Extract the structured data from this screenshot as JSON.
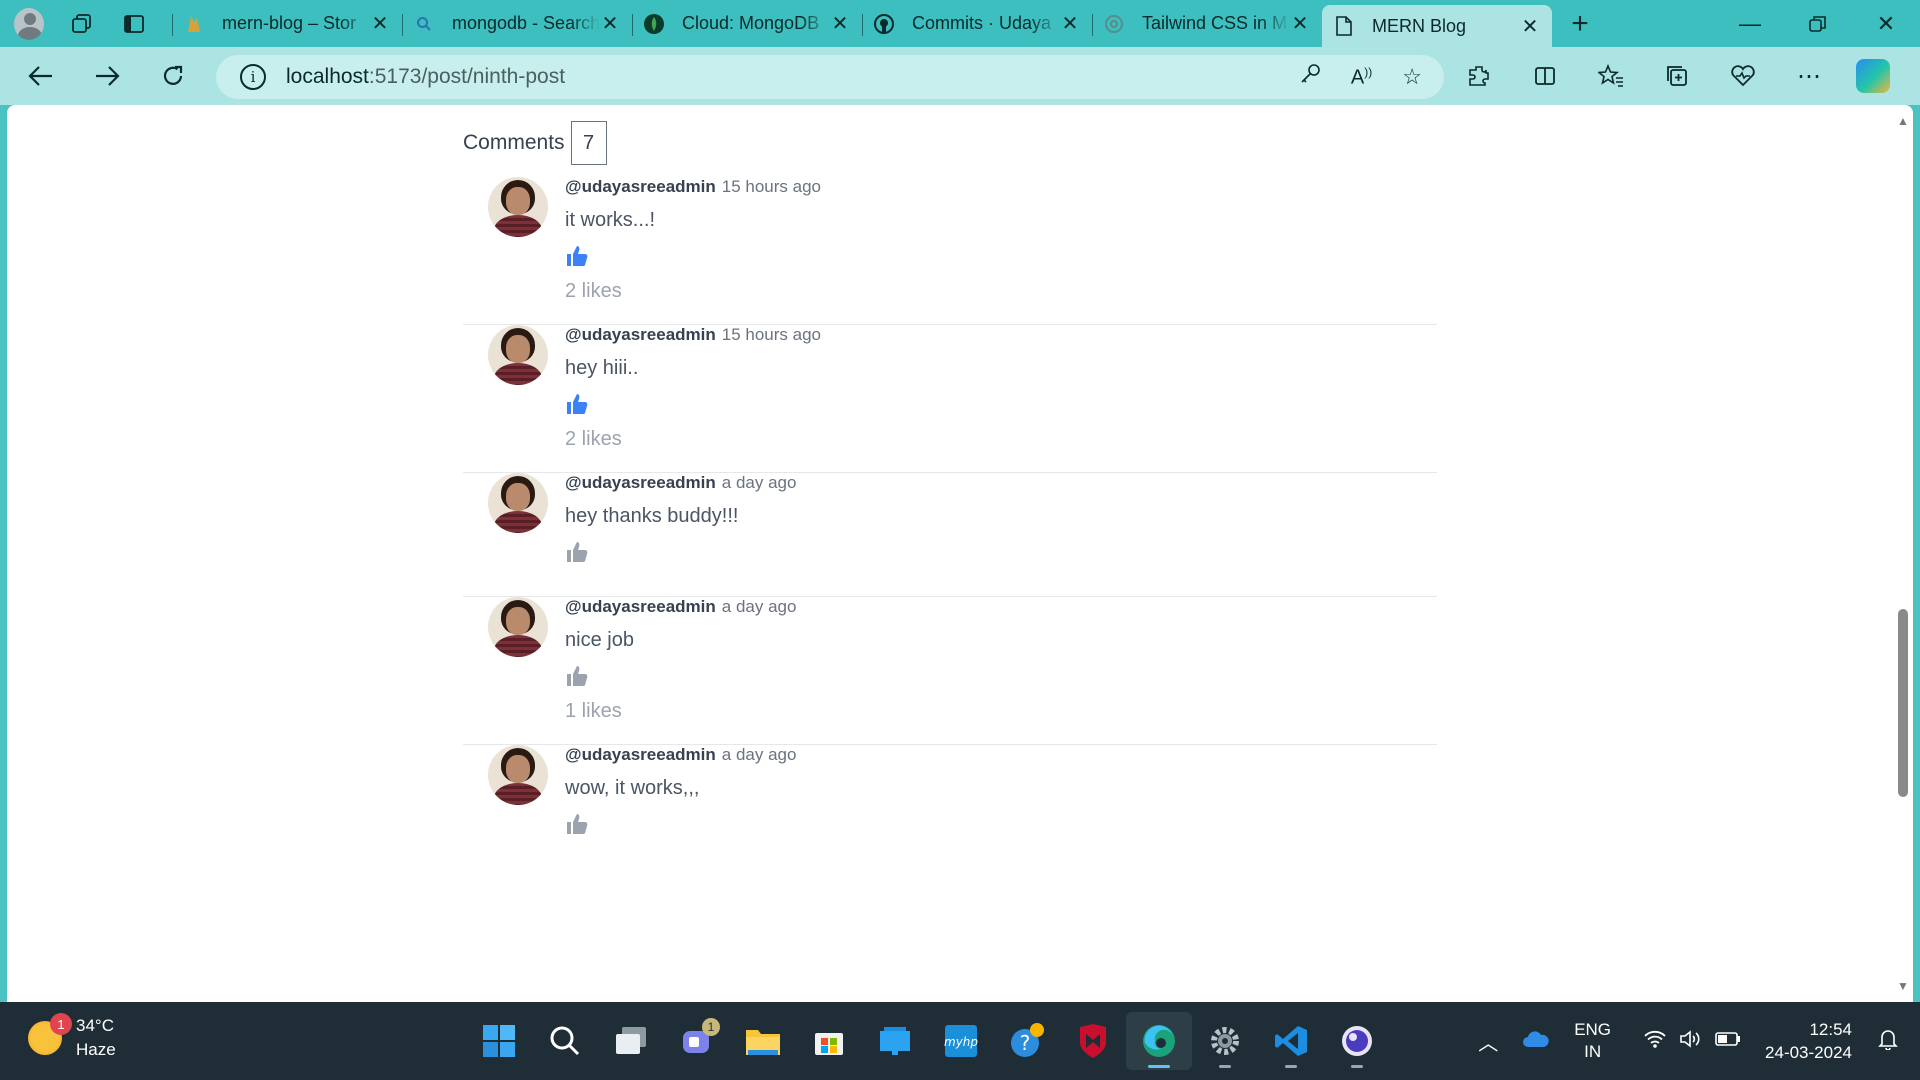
{
  "browser": {
    "tabs": [
      {
        "title": "mern-blog – Stor",
        "favicon": "firebase"
      },
      {
        "title": "mongodb - Search",
        "favicon": "search"
      },
      {
        "title": "Cloud: MongoDB",
        "favicon": "mongodb"
      },
      {
        "title": "Commits · Udaya",
        "favicon": "github"
      },
      {
        "title": "Tailwind CSS in M",
        "favicon": "openai"
      },
      {
        "title": "MERN Blog",
        "favicon": "page"
      }
    ],
    "address": {
      "host": "localhost",
      "path": ":5173/post/ninth-post"
    }
  },
  "comments_section": {
    "label": "Comments",
    "count": "7",
    "items": [
      {
        "username": "@udayasreeadmin",
        "time": "15 hours ago",
        "text": "it works...!",
        "liked": true,
        "likes": "2 likes"
      },
      {
        "username": "@udayasreeadmin",
        "time": "15 hours ago",
        "text": "hey hiii..",
        "liked": true,
        "likes": "2 likes"
      },
      {
        "username": "@udayasreeadmin",
        "time": "a day ago",
        "text": "hey thanks buddy!!!",
        "liked": false,
        "likes": ""
      },
      {
        "username": "@udayasreeadmin",
        "time": "a day ago",
        "text": "nice job",
        "liked": false,
        "likes": "1 likes"
      },
      {
        "username": "@udayasreeadmin",
        "time": "a day ago",
        "text": "wow, it works,,,",
        "liked": false,
        "likes": ""
      }
    ]
  },
  "colors": {
    "like_active": "#3b82f6",
    "like_inactive": "#9ca3af",
    "taskbar": "#1f2e36",
    "browser_frame": "#3dbfbf"
  },
  "taskbar": {
    "weather": {
      "temp": "34°C",
      "condition": "Haze",
      "badge": "1"
    },
    "teams_badge": "1",
    "lang": {
      "line1": "ENG",
      "line2": "IN"
    },
    "clock": {
      "time": "12:54",
      "date": "24-03-2024"
    }
  }
}
